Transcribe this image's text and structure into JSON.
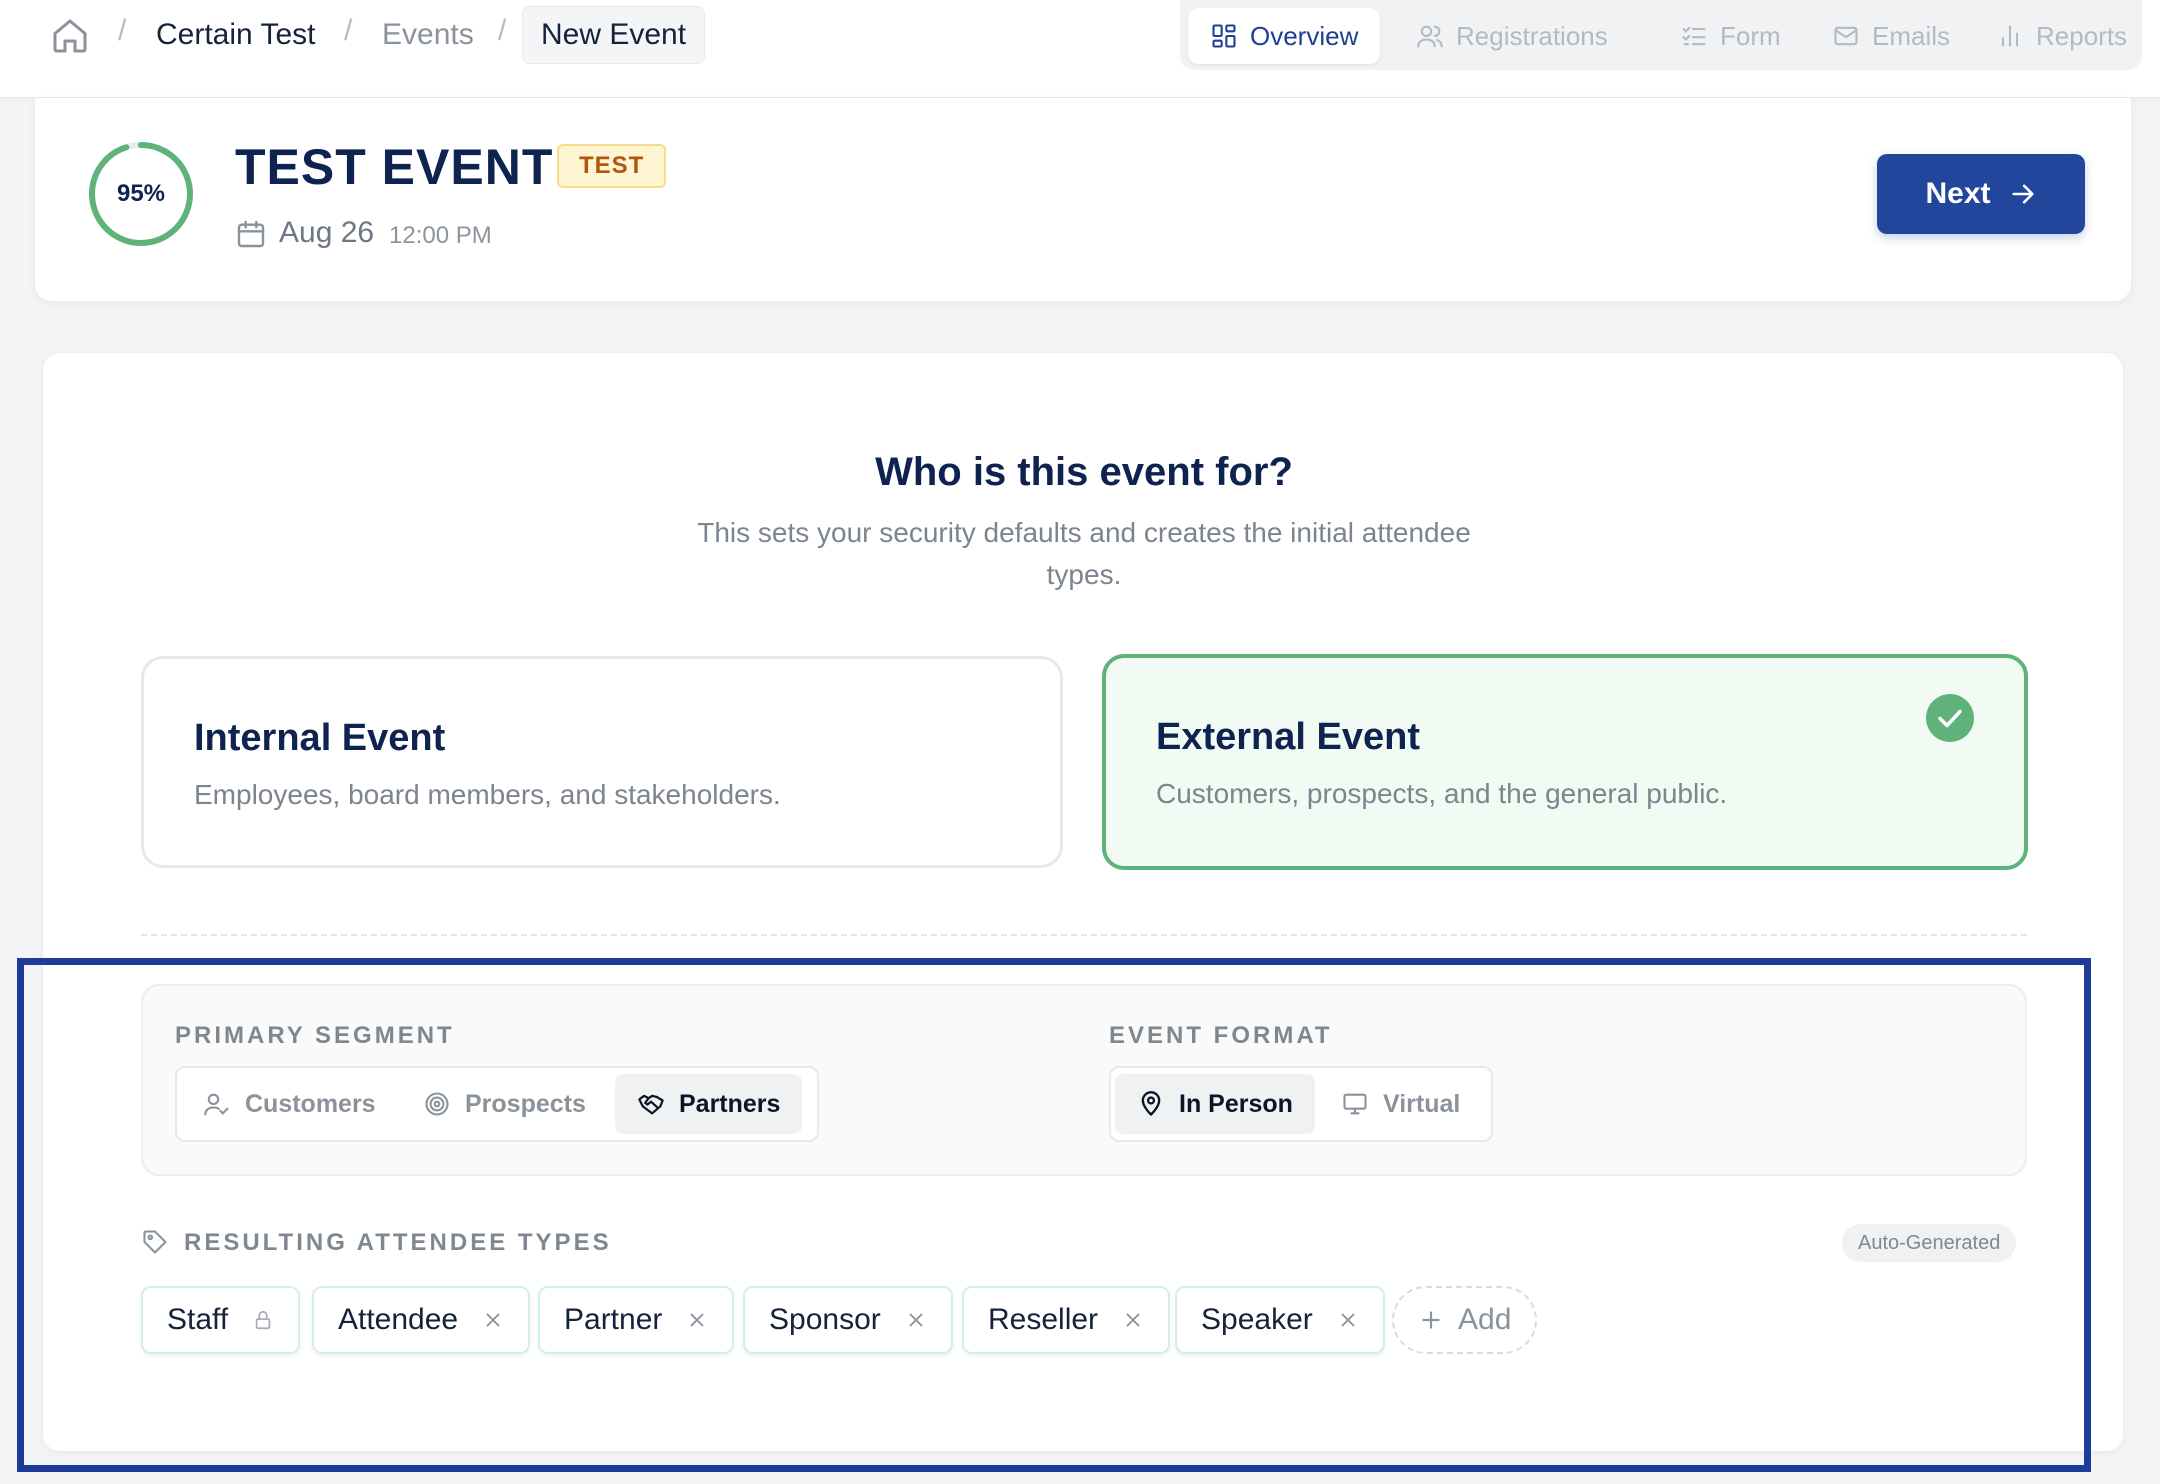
{
  "breadcrumb": {
    "items": [
      "Certain Test",
      "Events",
      "New Event"
    ],
    "separator": "/"
  },
  "tabs": [
    {
      "label": "Overview",
      "icon": "grid-icon",
      "active": true
    },
    {
      "label": "Registrations",
      "icon": "users-icon",
      "active": false
    },
    {
      "label": "Form",
      "icon": "checklist-icon",
      "active": false
    },
    {
      "label": "Emails",
      "icon": "mail-icon",
      "active": false
    },
    {
      "label": "Reports",
      "icon": "bar-chart-icon",
      "active": false
    }
  ],
  "header": {
    "progress_label": "95%",
    "progress": 0.95,
    "title": "TEST EVENT",
    "badge": "TEST",
    "date": "Aug 26",
    "time": "12:00 PM",
    "next_label": "Next"
  },
  "audience": {
    "question": "Who is this event for?",
    "subtitle": "This sets your security defaults and creates the initial attendee types.",
    "options": [
      {
        "title": "Internal Event",
        "description": "Employees, board members, and stakeholders.",
        "selected": false
      },
      {
        "title": "External Event",
        "description": "Customers, prospects, and the general public.",
        "selected": true
      }
    ]
  },
  "segment": {
    "label": "PRIMARY SEGMENT",
    "options": [
      {
        "label": "Customers",
        "icon": "user-check-icon",
        "active": false
      },
      {
        "label": "Prospects",
        "icon": "target-icon",
        "active": false
      },
      {
        "label": "Partners",
        "icon": "handshake-icon",
        "active": true
      }
    ]
  },
  "format": {
    "label": "EVENT FORMAT",
    "options": [
      {
        "label": "In Person",
        "icon": "map-pin-icon",
        "active": true
      },
      {
        "label": "Virtual",
        "icon": "monitor-icon",
        "active": false
      }
    ]
  },
  "attendee_types": {
    "label": "RESULTING ATTENDEE TYPES",
    "badge": "Auto-Generated",
    "items": [
      {
        "label": "Staff",
        "action_icon": "lock-icon"
      },
      {
        "label": "Attendee",
        "action_icon": "close-icon"
      },
      {
        "label": "Partner",
        "action_icon": "close-icon"
      },
      {
        "label": "Sponsor",
        "action_icon": "close-icon"
      },
      {
        "label": "Reseller",
        "action_icon": "close-icon"
      },
      {
        "label": "Speaker",
        "action_icon": "close-icon"
      }
    ],
    "add_label": "Add"
  },
  "colors": {
    "accent": "#21469b",
    "success": "#5fb37a",
    "badge_bg": "#fef5d3",
    "badge_text": "#b2560c",
    "selection_frame": "#1d3b9a"
  }
}
